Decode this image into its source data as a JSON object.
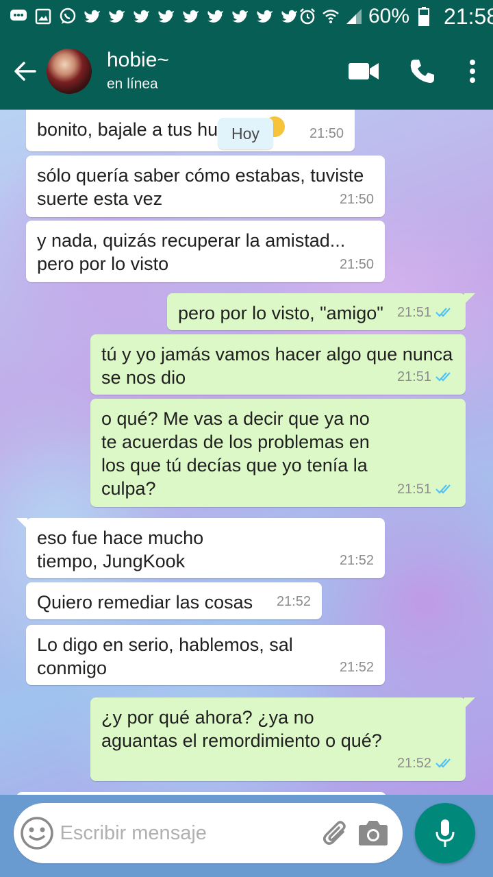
{
  "status_bar": {
    "battery": "60%",
    "clock": "21:58",
    "icons": [
      "chat-bubble-icon",
      "image-icon",
      "whatsapp-icon",
      "twitter-icon",
      "alarm-icon",
      "wifi-icon",
      "signal-icon",
      "battery-icon"
    ]
  },
  "header": {
    "contact_name": "hobie~",
    "status": "en línea"
  },
  "date_chip": "Hoy",
  "messages": [
    {
      "dir": "in",
      "text": "bonito, bajale a tus hu",
      "time": "21:50"
    },
    {
      "dir": "in",
      "text": "sólo quería saber cómo estabas, tuviste suerte esta vez",
      "time": "21:50"
    },
    {
      "dir": "in",
      "text": "y nada, quizás recuperar la amistad... pero por lo visto",
      "time": "21:50"
    },
    {
      "dir": "out",
      "text": "pero por lo visto, \"amigo\"",
      "time": "21:51"
    },
    {
      "dir": "out",
      "text": "tú y yo jamás vamos hacer algo que nunca se nos dio",
      "time": "21:51"
    },
    {
      "dir": "out",
      "text": "o qué? Me vas a decir que ya no te acuerdas de los problemas en los que tú decías que yo tenía la culpa?",
      "time": "21:51"
    },
    {
      "dir": "in",
      "text": "eso fue hace mucho tiempo, JungKook",
      "time": "21:52"
    },
    {
      "dir": "in",
      "text": "Quiero remediar las cosas",
      "time": "21:52"
    },
    {
      "dir": "in",
      "text": "Lo digo en serio, hablemos, sal conmigo",
      "time": "21:52"
    },
    {
      "dir": "out",
      "text": "¿y por qué ahora? ¿ya no aguantas el remordimiento o qué?",
      "time": "21:52"
    }
  ],
  "input": {
    "placeholder": "Escribir mensaje",
    "value": ""
  },
  "colors": {
    "header": "#075e54",
    "outgoing_bubble": "#dcf8c6",
    "incoming_bubble": "#ffffff",
    "read_ticks": "#4fc3f7",
    "mic_button": "#00897b"
  }
}
